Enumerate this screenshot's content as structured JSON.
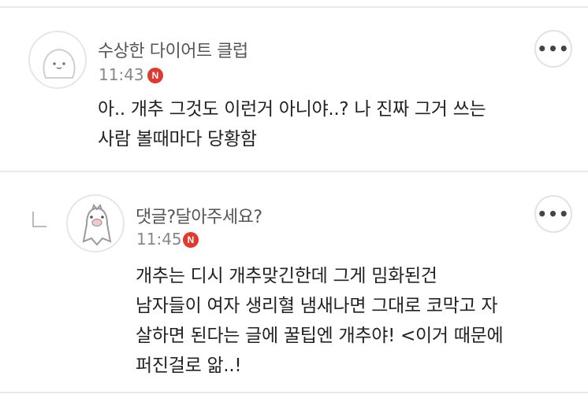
{
  "comments": [
    {
      "nickname": "수상한 다이어트 클럽",
      "time": "11:43",
      "badge": "N",
      "more": "•••",
      "lines": [
        "아.. 개추 그것도 이런거 아니야..? 나 진짜 그거 쓰는",
        "사람 볼때마다 당황함"
      ]
    },
    {
      "nickname": "댓글?달아주세요?",
      "time": "11:45",
      "badge": "N",
      "more": "•••",
      "lines": [
        "개추는 디시 개추맞긴한데 그게 밈화된건",
        "남자들이 여자 생리혈 냄새나면 그대로 코막고 자",
        "살하면 된다는 글에 꿀팁엔 개추야! <이거 때문에",
        "퍼진걸로 앎..!"
      ]
    }
  ],
  "colors": {
    "badge": "#e03a2f",
    "divider": "#e9e9e9",
    "text": "#222222",
    "meta": "#888888"
  }
}
